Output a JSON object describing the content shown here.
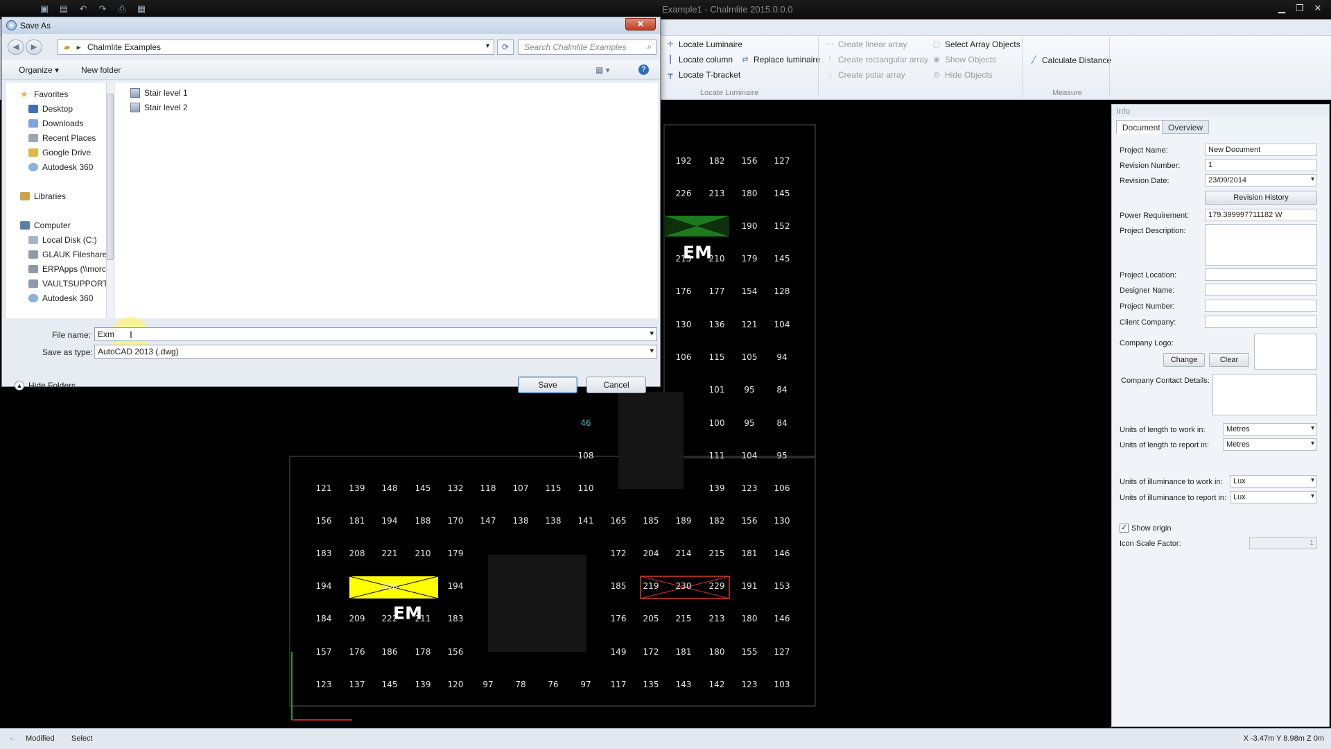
{
  "app": {
    "title": "Example1 - Chalmlite 2015.0.0.0",
    "status_left": "Modified",
    "status_mode": "Select",
    "status_coords": "X -3.47m Y 8.98m Z 0m",
    "colors": {
      "accent": "#4fb7c9",
      "yellow_luminaire": "#ffff00",
      "green_luminaire": "#1e8a1e",
      "red_luminaire": "#d43a2a"
    }
  },
  "ribbon": {
    "locate_luminaire": "Locate Luminaire",
    "locate_column": "Locate column",
    "locate_tbracket": "Locate T-bracket",
    "replace_luminaire": "Replace luminaire",
    "group_locate": "Locate Luminaire",
    "create_linear": "Create linear array",
    "create_rect": "Create rectangular array",
    "create_polar": "Create polar array",
    "select_array": "Select Array Objects",
    "show_objects": "Show Objects",
    "hide_objects": "Hide Objects",
    "calc_distance": "Calculate Distance",
    "group_measure": "Measure"
  },
  "dialog": {
    "title": "Save As",
    "address": "Chalmlite Examples",
    "search_placeholder": "Search Chalmlite Examples",
    "organize": "Organize ▾",
    "new_folder": "New folder",
    "nav": {
      "favorites": "Favorites",
      "desktop": "Desktop",
      "downloads": "Downloads",
      "recent": "Recent Places",
      "gdrive": "Google Drive",
      "a360": "Autodesk 360",
      "libraries": "Libraries",
      "computer": "Computer",
      "localdisk": "Local Disk (C:)",
      "glauk": "GLAUK Fileshare",
      "erpapps": "ERPApps (\\\\morc",
      "vault": "VAULTSUPPORT",
      "a360b": "Autodesk 360"
    },
    "files": [
      "Stair level 1",
      "Stair level 2"
    ],
    "filename_label": "File name:",
    "filename_value": "Exm",
    "savetype_label": "Save as type:",
    "savetype_value": "AutoCAD 2013 (.dwg)",
    "hide_folders": "Hide Folders",
    "save": "Save",
    "cancel": "Cancel"
  },
  "info": {
    "header": "Info",
    "tab_document": "Document",
    "tab_overview": "Overview",
    "project_name_label": "Project Name:",
    "project_name": "New Document",
    "revision_number_label": "Revision Number:",
    "revision_number": "1",
    "revision_date_label": "Revision Date:",
    "revision_date": "23/09/2014",
    "revision_history": "Revision History",
    "power_label": "Power Requirement:",
    "power": "179.399997711182 W",
    "description_label": "Project Description:",
    "location_label": "Project Location:",
    "designer_label": "Designer Name:",
    "number_label": "Project Number:",
    "client_label": "Client Company:",
    "logo_label": "Company Logo:",
    "change": "Change",
    "clear": "Clear",
    "contact_label": "Company Contact Details:",
    "len_work_label": "Units of length to work in:",
    "len_work": "Metres",
    "len_report_label": "Units of length to report in:",
    "len_report": "Metres",
    "lux_work_label": "Units of illuminance to work in:",
    "lux_work": "Lux",
    "lux_report_label": "Units of illuminance to report in:",
    "lux_report": "Lux",
    "show_origin": "Show origin",
    "icon_scale_label": "Icon Scale Factor:",
    "icon_scale": "1"
  },
  "canvas": {
    "em_label": "EM",
    "cyan_value": "46",
    "rows": [
      [
        "192",
        "182",
        "156",
        "127"
      ],
      [
        "226",
        "213",
        "180",
        "145"
      ],
      [
        "190",
        "152"
      ],
      [
        "215",
        "210",
        "179",
        "145"
      ],
      [
        "176",
        "177",
        "154",
        "128"
      ],
      [
        "130",
        "136",
        "121",
        "104"
      ],
      [
        "106",
        "115",
        "105",
        "94"
      ],
      [
        "101",
        "95",
        "84"
      ],
      [
        "100",
        "95",
        "84"
      ],
      [
        "108",
        "111",
        "104",
        "95"
      ],
      [
        "121",
        "139",
        "148",
        "145",
        "132",
        "118",
        "107",
        "115",
        "110",
        "139",
        "123",
        "106"
      ],
      [
        "156",
        "181",
        "194",
        "188",
        "170",
        "147",
        "138",
        "138",
        "141",
        "165",
        "185",
        "189",
        "182",
        "156",
        "130"
      ],
      [
        "183",
        "208",
        "221",
        "210",
        "179",
        "172",
        "204",
        "214",
        "215",
        "181",
        "146"
      ],
      [
        "194",
        "208",
        "194",
        "185",
        "219",
        "230",
        "229",
        "191",
        "153"
      ],
      [
        "184",
        "209",
        "222",
        "211",
        "183",
        "176",
        "205",
        "215",
        "213",
        "180",
        "146"
      ],
      [
        "157",
        "176",
        "186",
        "178",
        "156",
        "149",
        "172",
        "181",
        "180",
        "155",
        "127"
      ],
      [
        "123",
        "137",
        "145",
        "139",
        "120",
        "97",
        "78",
        "76",
        "97",
        "117",
        "135",
        "143",
        "142",
        "123",
        "103"
      ]
    ]
  }
}
